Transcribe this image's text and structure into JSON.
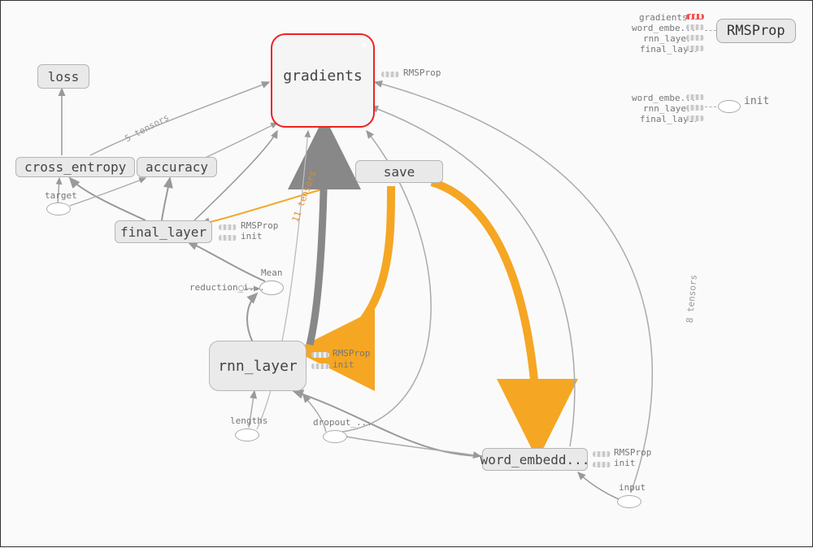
{
  "nodes": {
    "loss": {
      "label": "loss"
    },
    "cross_entropy": {
      "label": "cross_entropy"
    },
    "accuracy": {
      "label": "accuracy"
    },
    "gradients": {
      "label": "gradients"
    },
    "save": {
      "label": "save"
    },
    "final_layer": {
      "label": "final_layer"
    },
    "rnn_layer": {
      "label": "rnn_layer"
    },
    "word_embedd": {
      "label": "word_embedd..."
    },
    "mean": {
      "label": "Mean"
    },
    "reduction_i": {
      "label": "reduction_i..."
    },
    "target": {
      "label": "target"
    },
    "lengths": {
      "label": "lengths"
    },
    "dropout": {
      "label": "dropout_..."
    },
    "input": {
      "label": "input"
    }
  },
  "side_annotations": {
    "rmsprop": "RMSProp",
    "init": "init"
  },
  "legend_top": {
    "items": [
      {
        "label": "gradients",
        "highlight": true
      },
      {
        "label": "word_embe...",
        "highlight": false
      },
      {
        "label": "rnn_layer",
        "highlight": false
      },
      {
        "label": "final_layer",
        "highlight": false
      }
    ],
    "target": "RMSProp"
  },
  "legend_mid": {
    "items": [
      {
        "label": "word_embe..."
      },
      {
        "label": "rnn_layer"
      },
      {
        "label": "final_layer"
      }
    ],
    "target": "init"
  },
  "edge_text": {
    "s_tensors": "5 tensors",
    "e_tensors": "8 tensors",
    "t11": "11 tensors"
  }
}
